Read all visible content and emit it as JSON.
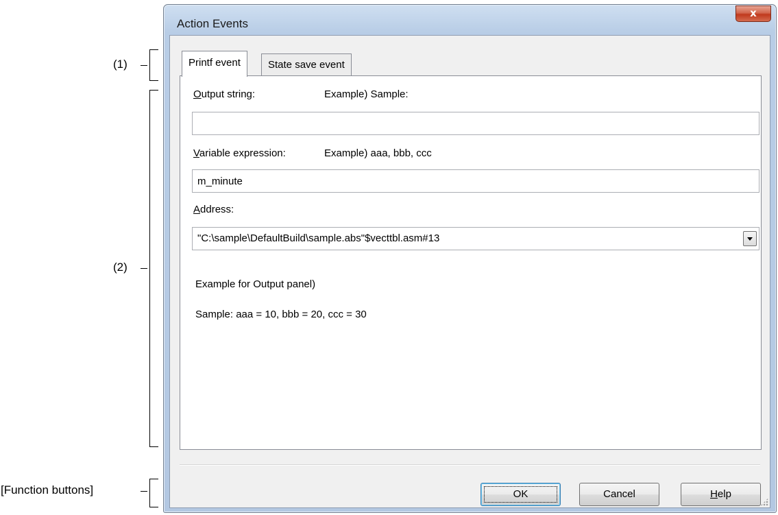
{
  "annotations": {
    "tabs": "(1)",
    "panel": "(2)",
    "function_buttons": "[Function buttons]"
  },
  "window": {
    "title": "Action Events",
    "close_glyph": "x"
  },
  "tabs": [
    {
      "label": "Printf event",
      "active": true
    },
    {
      "label": "State save event",
      "active": false
    }
  ],
  "form": {
    "output_string": {
      "label_mnemonic": "O",
      "label_rest": "utput string:",
      "example": "Example) Sample:",
      "value": ""
    },
    "variable_expression": {
      "label_mnemonic": "V",
      "label_rest": "ariable expression:",
      "example": "Example) aaa, bbb, ccc",
      "value": "m_minute"
    },
    "address": {
      "label_mnemonic": "A",
      "label_rest": "ddress:",
      "value": "\"C:\\sample\\DefaultBuild\\sample.abs\"$vecttbl.asm#13"
    },
    "output_example_heading": "Example for Output panel)",
    "output_example_text": "Sample: aaa = 10, bbb = 20, ccc = 30"
  },
  "buttons": {
    "ok": "OK",
    "cancel": "Cancel",
    "help_mnemonic": "H",
    "help_rest": "elp"
  },
  "colors": {
    "frame": "#b8cde6",
    "client": "#f0f0f0",
    "close_button": "#c0391d"
  }
}
